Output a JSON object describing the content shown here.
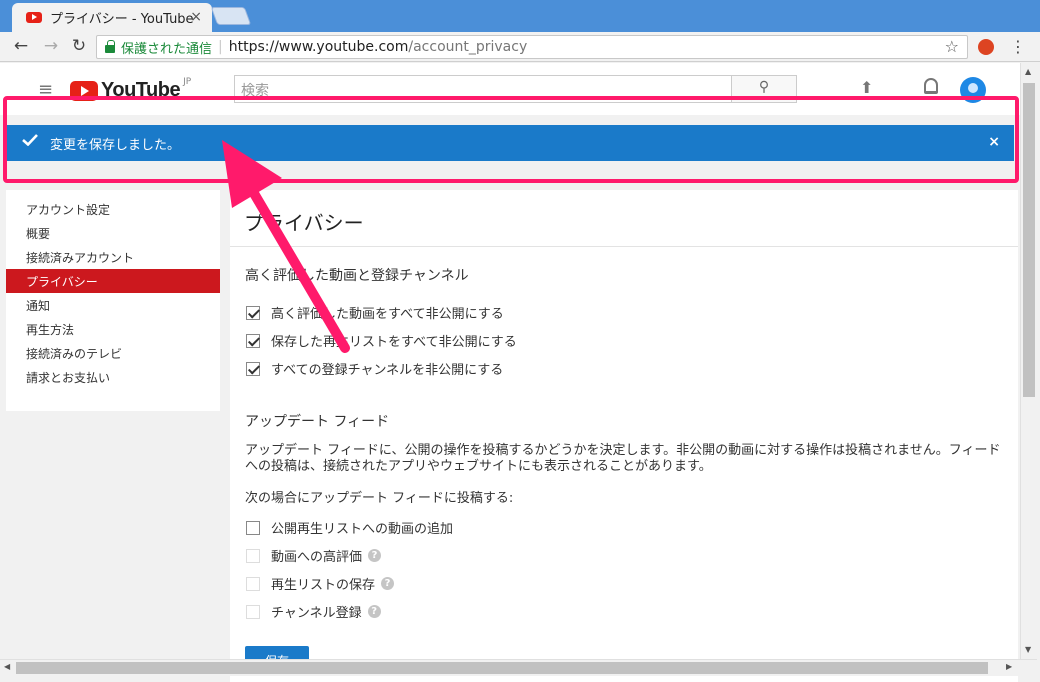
{
  "browser": {
    "tab_title": "プライバシー - YouTube",
    "tab_close": "×",
    "secure_label": "保護された通信",
    "url_host": "https://www.youtube.com",
    "url_path": "/account_privacy",
    "back": "←",
    "forward": "→",
    "reload": "↻",
    "star": "☆",
    "menu": "⋮"
  },
  "header": {
    "logo_text": "YouTube",
    "logo_region": "JP",
    "search_placeholder": "検索",
    "search_icon": "⚲"
  },
  "notification": {
    "message": "変更を保存しました。",
    "close": "×"
  },
  "sidebar": {
    "items": [
      {
        "label": "アカウント設定"
      },
      {
        "label": "概要"
      },
      {
        "label": "接続済みアカウント"
      },
      {
        "label": "プライバシー"
      },
      {
        "label": "通知"
      },
      {
        "label": "再生方法"
      },
      {
        "label": "接続済みのテレビ"
      },
      {
        "label": "請求とお支払い"
      }
    ]
  },
  "main": {
    "title": "プライバシー",
    "section1_title": "高く評価した動画と登録チャンネル",
    "section1_options": [
      {
        "label": "高く評価した動画をすべて非公開にする",
        "checked": true
      },
      {
        "label": "保存した再生リストをすべて非公開にする",
        "checked": true
      },
      {
        "label": "すべての登録チャンネルを非公開にする",
        "checked": true
      }
    ],
    "section2_title": "アップデート フィード",
    "section2_desc": "アップデート フィードに、公開の操作を投稿するかどうかを決定します。非公開の動画に対する操作は投稿されません。フィードへの投稿は、接続されたアプリやウェブサイトにも表示されることがあります。",
    "section2_sub": "次の場合にアップデート フィードに投稿する:",
    "section2_options": [
      {
        "label": "公開再生リストへの動画の追加",
        "checked": false
      },
      {
        "label": "動画への高評価",
        "checked": false
      },
      {
        "label": "再生リストの保存",
        "checked": false
      },
      {
        "label": "チャンネル登録",
        "checked": false
      }
    ],
    "help_glyph": "?",
    "save_label": "保存"
  },
  "colors": {
    "notification_bg": "#1a7ac9",
    "highlight": "#ff1a6b",
    "active_nav": "#cc181e"
  }
}
